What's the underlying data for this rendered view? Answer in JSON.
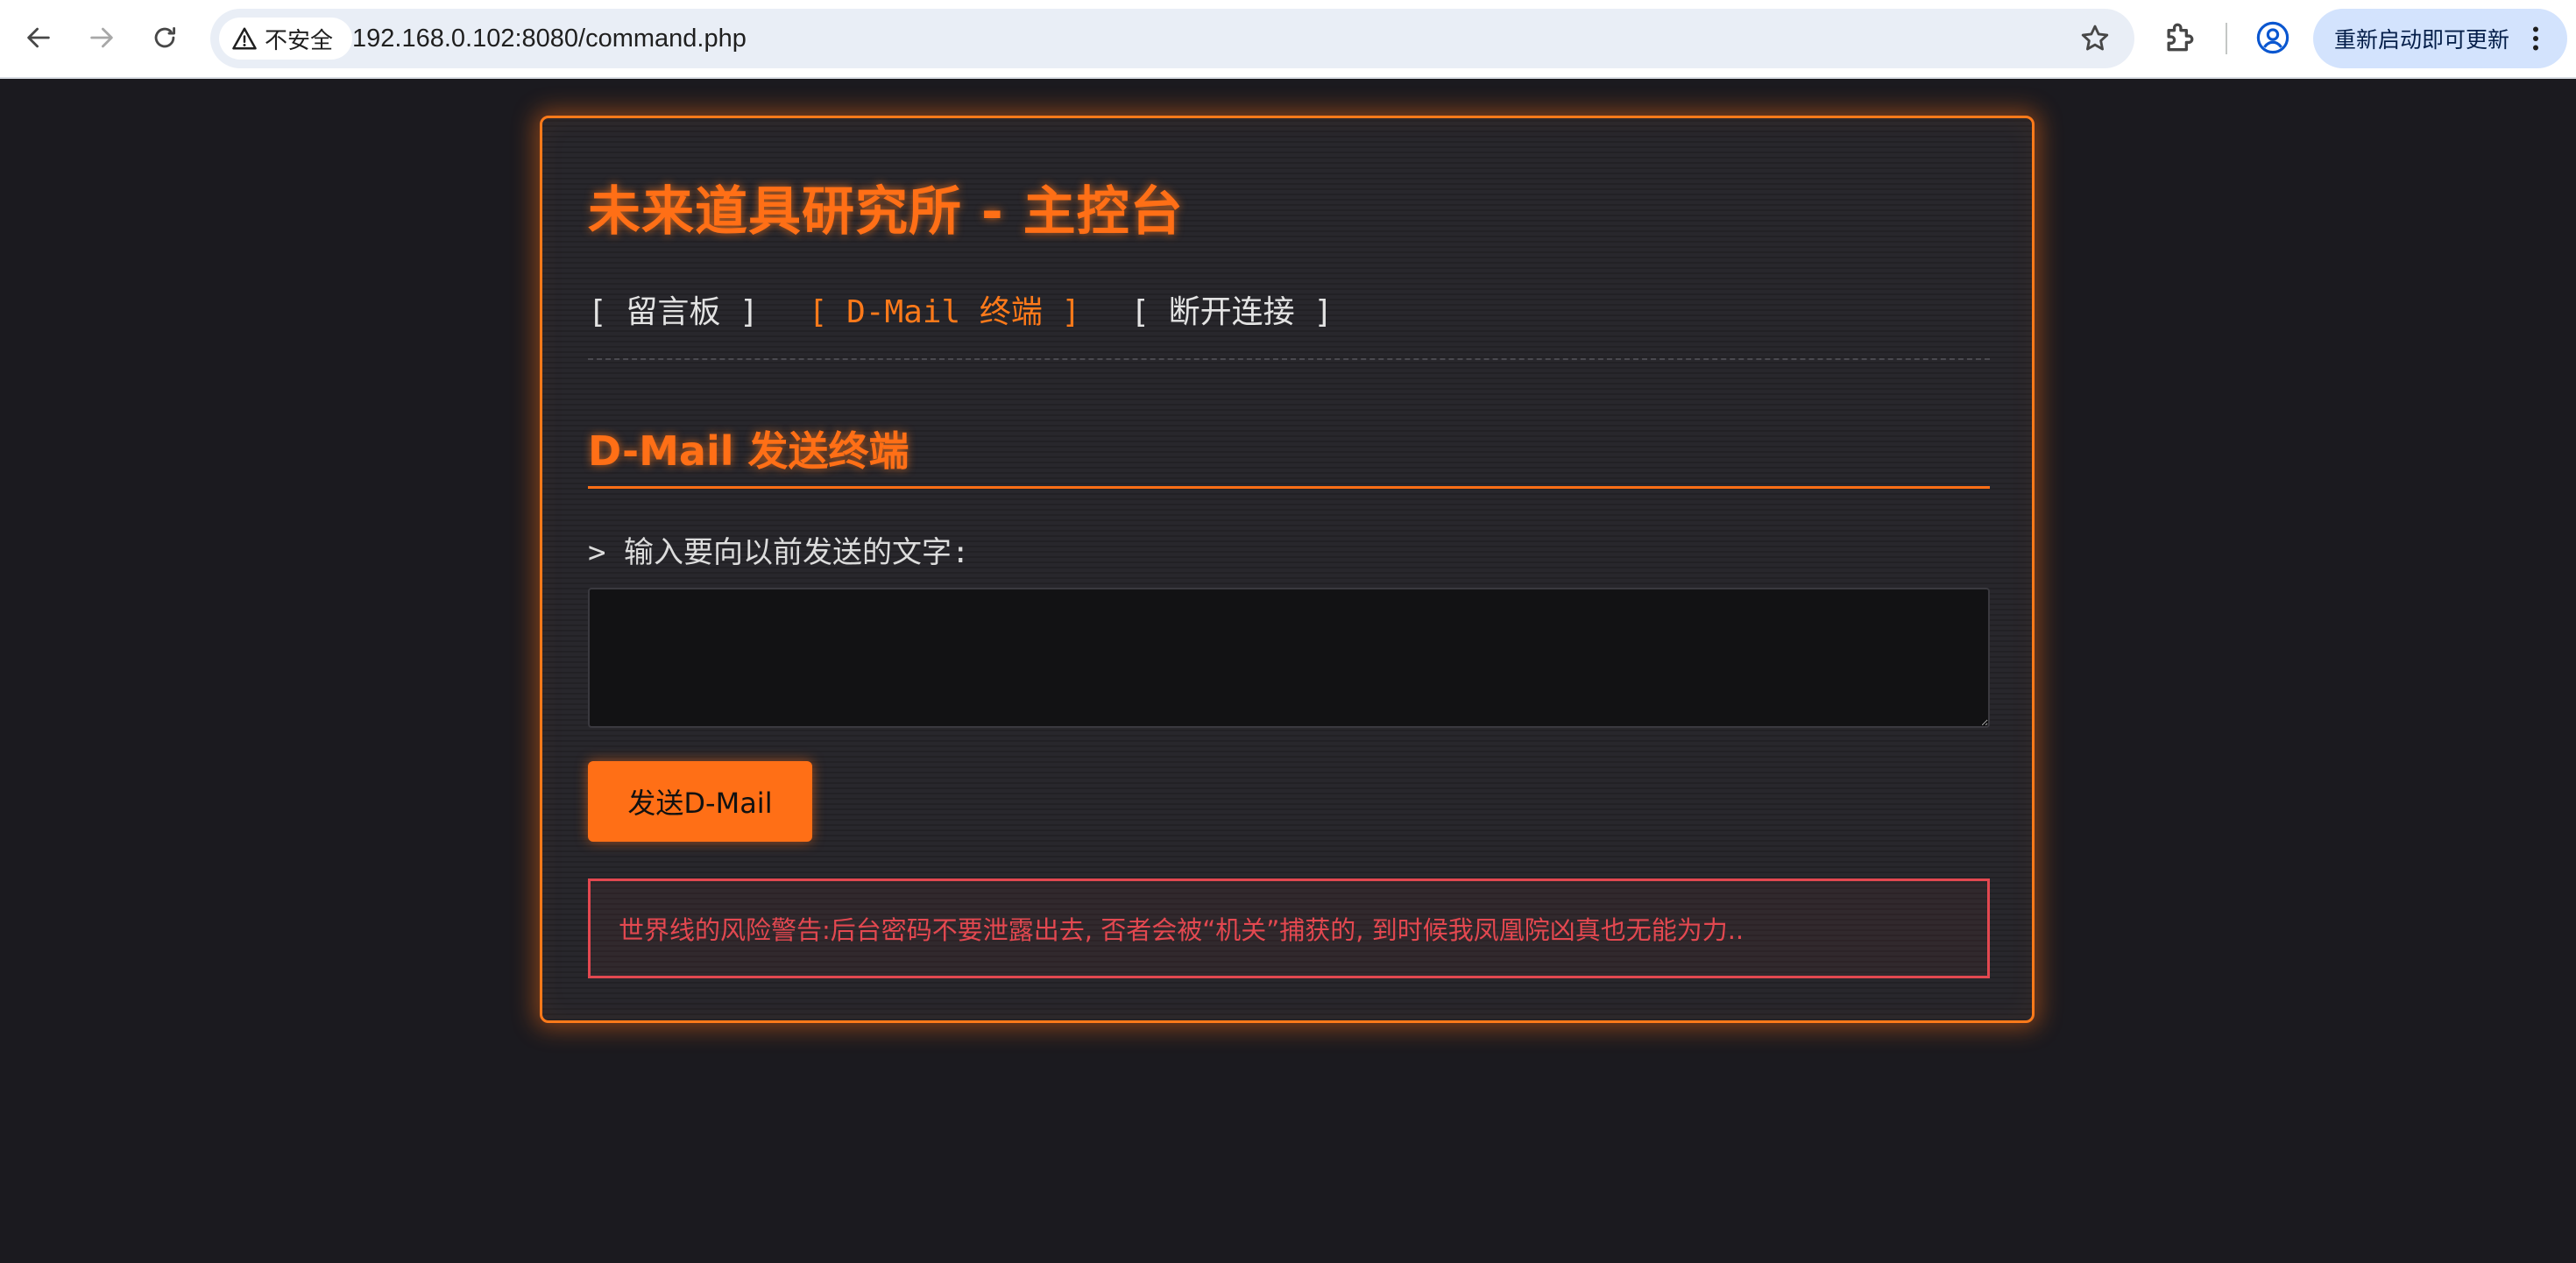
{
  "browser": {
    "security_label": "不安全",
    "url": "192.168.0.102:8080/command.php",
    "update_button_label": "重新启动即可更新",
    "icons": [
      "back-arrow-icon",
      "forward-arrow-icon",
      "reload-icon",
      "warning-triangle-icon",
      "star-icon",
      "extensions-puzzle-icon",
      "profile-icon",
      "more-vert-icon"
    ]
  },
  "page": {
    "title": "未来道具研究所 - 主控台",
    "nav": [
      {
        "label": "[ 留言板 ]",
        "active": false
      },
      {
        "label": "[ D-Mail 终端 ]",
        "active": true
      },
      {
        "label": "[ 断开连接 ]",
        "active": false
      }
    ],
    "section_title": "D-Mail 发送终端",
    "prompt_label": "> 输入要向以前发送的文字:",
    "textarea_value": "",
    "send_button_label": "发送D-Mail",
    "warning_text": "世界线的风险警告:后台密码不要泄露出去, 否者会被“机关”捕获的, 到时候我凤凰院凶真也无能为力..",
    "colors": {
      "background": "#1b1a1f",
      "panel": "#28272c",
      "accent": "#ff6f16",
      "warning": "#e34850",
      "text": "#e3e3e3"
    }
  }
}
